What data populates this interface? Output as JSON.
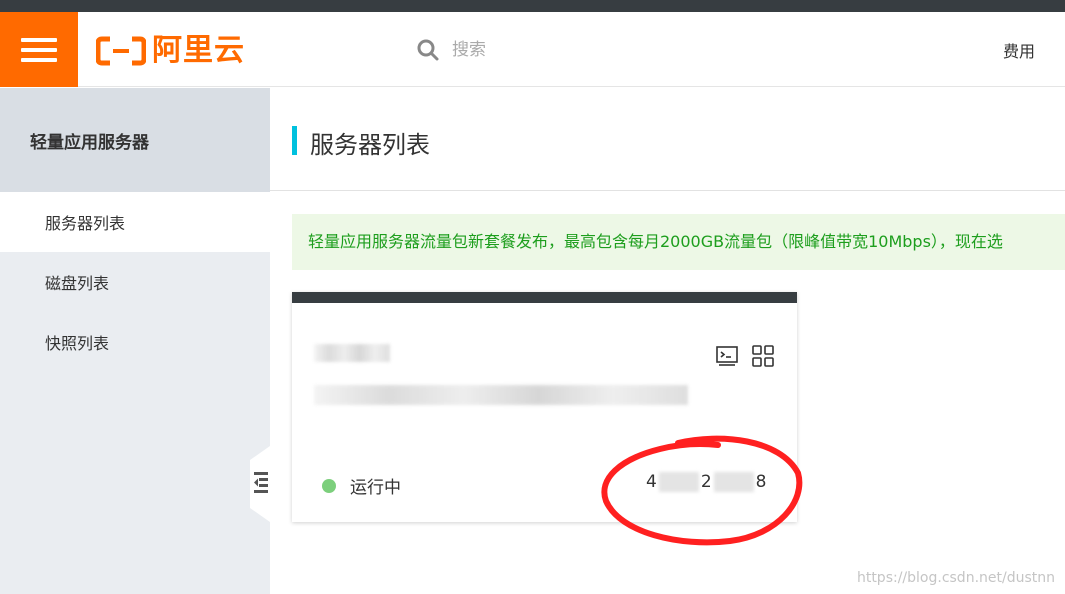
{
  "header": {
    "logo_text": "阿里云",
    "search_placeholder": "搜索",
    "link_billing": "费用"
  },
  "sidebar": {
    "title": "轻量应用服务器",
    "items": [
      {
        "label": "服务器列表",
        "active": true
      },
      {
        "label": "磁盘列表",
        "active": false
      },
      {
        "label": "快照列表",
        "active": false
      }
    ]
  },
  "main": {
    "page_title": "服务器列表",
    "notice": "轻量应用服务器流量包新套餐发布，最高包含每月2000GB流量包（限峰值带宽10Mbps），现在选",
    "card": {
      "status": "运行中",
      "ip_start": "4",
      "ip_mid": "2",
      "ip_end": "8"
    }
  },
  "watermark": "https://blog.csdn.net/dustnn",
  "colors": {
    "brand_orange": "#ff6a00",
    "accent_cyan": "#00c1de",
    "status_green": "#7ccf7c",
    "notice_green": "#1d9e1d",
    "annotation_red": "#ff2020"
  }
}
